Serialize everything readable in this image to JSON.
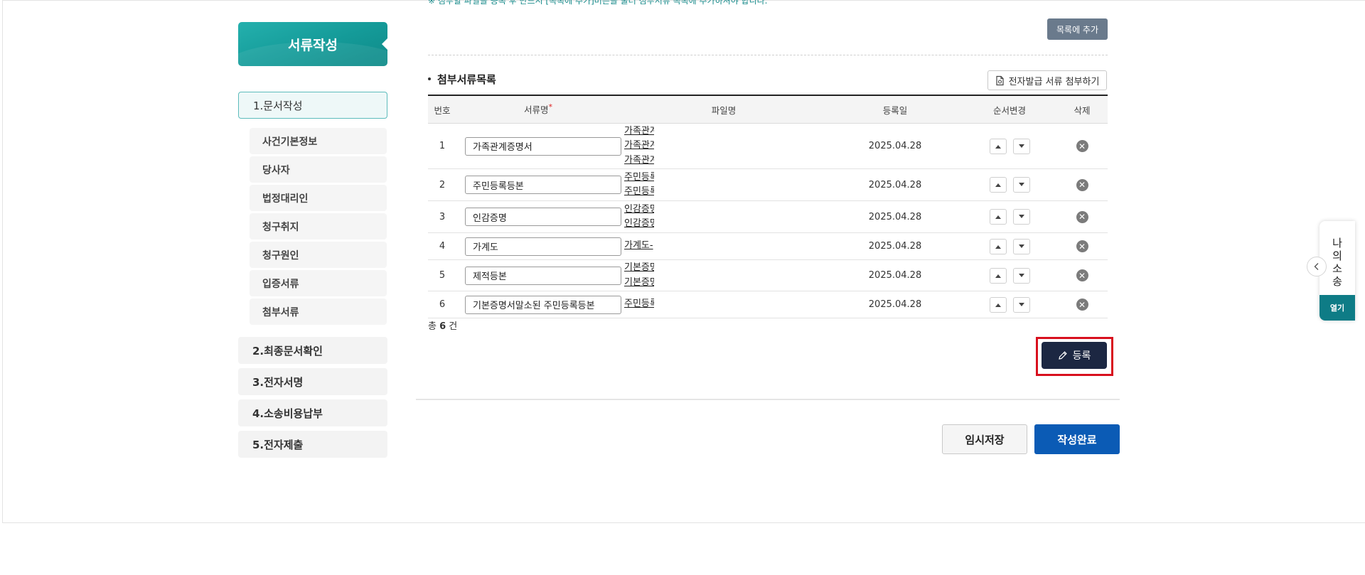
{
  "notice": "※ 첨부할 파일을 등록 후 반드시 [목록에 추가]버튼을 눌러 첨부서류 목록에 추가하셔야 합니다.",
  "nav": {
    "header": "서류작성",
    "steps": [
      {
        "label": "1.문서작성",
        "active": true
      },
      {
        "label": "2.최종문서확인"
      },
      {
        "label": "3.전자서명"
      },
      {
        "label": "4.소송비용납부"
      },
      {
        "label": "5.전자제출"
      }
    ],
    "sub_items": [
      "사건기본정보",
      "당사자",
      "법정대리인",
      "청구취지",
      "청구원인",
      "입증서류",
      "첨부서류"
    ]
  },
  "toolbar": {
    "add_to_list": "목록에 추가",
    "e_attach": "전자발급 서류 첨부하기"
  },
  "section": {
    "title": "첨부서류목록"
  },
  "table": {
    "headers": {
      "no": "번호",
      "doc_name": "서류명",
      "file_name": "파일명",
      "date": "등록일",
      "order": "순서변경",
      "delete": "삭제"
    },
    "rows": [
      {
        "no": "1",
        "doc_name": "가족관계증명서",
        "files": [
          "가족관계",
          "가족관계",
          "가족관계"
        ],
        "date": "2025.04.28"
      },
      {
        "no": "2",
        "doc_name": "주민등록등본",
        "files": [
          "주민등록",
          "주민등록"
        ],
        "date": "2025.04.28"
      },
      {
        "no": "3",
        "doc_name": "인감증명",
        "files": [
          "인감증명",
          "인감증명"
        ],
        "date": "2025.04.28"
      },
      {
        "no": "4",
        "doc_name": "가계도",
        "files": [
          "가계도-"
        ],
        "date": "2025.04.28"
      },
      {
        "no": "5",
        "doc_name": "제적등본",
        "files": [
          "기본증명",
          "기본증명"
        ],
        "date": "2025.04.28"
      },
      {
        "no": "6",
        "doc_name": "기본증명서말소된 주민등록등본",
        "files": [
          "주민등록"
        ],
        "date": "2025.04.28"
      }
    ]
  },
  "total": {
    "prefix": "총",
    "count": "6",
    "suffix": "건"
  },
  "buttons": {
    "register": "등록",
    "temp_save": "임시저장",
    "complete": "작성완료"
  },
  "side": {
    "title_chars": [
      "나",
      "의",
      "소",
      "송"
    ],
    "open": "열기"
  },
  "colors": {
    "teal": "#149a98",
    "navy": "#1c2742",
    "blue": "#0b5bb5",
    "highlight": "#d8101e"
  }
}
